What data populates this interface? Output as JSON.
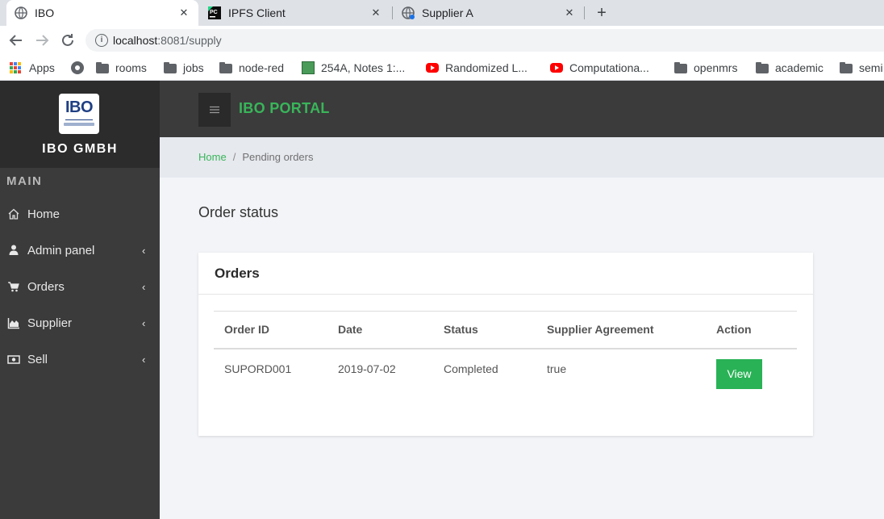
{
  "browser": {
    "tabs": [
      {
        "title": "IBO",
        "icon": "globe-icon",
        "active": true
      },
      {
        "title": "IPFS Client",
        "icon": "pycharm-icon",
        "active": false
      },
      {
        "title": "Supplier A",
        "icon": "globe-icon",
        "active": false
      }
    ],
    "close_glyph": "✕",
    "new_tab_glyph": "+",
    "url_host": "localhost",
    "url_path": ":8081/supply",
    "bookmarks": [
      {
        "label": "Apps",
        "icon": "apps-grid-icon"
      },
      {
        "label": "",
        "icon": "globe-icon"
      },
      {
        "label": "rooms",
        "icon": "folder-icon"
      },
      {
        "label": "jobs",
        "icon": "folder-icon"
      },
      {
        "label": "node-red",
        "icon": "folder-icon"
      },
      {
        "label": "254A, Notes 1:...",
        "icon": "sheet-icon"
      },
      {
        "label": "Randomized L...",
        "icon": "youtube-icon"
      },
      {
        "label": "Computationa...",
        "icon": "youtube-icon"
      },
      {
        "label": "openmrs",
        "icon": "folder-icon"
      },
      {
        "label": "academic",
        "icon": "folder-icon"
      },
      {
        "label": "semi",
        "icon": "folder-icon"
      }
    ]
  },
  "sidebar": {
    "logo_text": "IBO",
    "brand": "IBO GMBH",
    "section": "MAIN",
    "items": [
      {
        "label": "Home",
        "icon": "home-icon",
        "chevron": ""
      },
      {
        "label": "Admin panel",
        "icon": "user-icon",
        "chevron": "‹"
      },
      {
        "label": "Orders",
        "icon": "cart-icon",
        "chevron": "‹"
      },
      {
        "label": "Supplier",
        "icon": "area-chart-icon",
        "chevron": "‹"
      },
      {
        "label": "Sell",
        "icon": "money-icon",
        "chevron": "‹"
      }
    ]
  },
  "header": {
    "title": "IBO PORTAL"
  },
  "breadcrumb": {
    "home": "Home",
    "separator": "/",
    "current": "Pending orders"
  },
  "main": {
    "title": "Order status",
    "card_title": "Orders",
    "columns": [
      "Order ID",
      "Date",
      "Status",
      "Supplier Agreement",
      "Action"
    ],
    "rows": [
      {
        "order_id": "SUPORD001",
        "date": "2019-07-02",
        "status": "Completed",
        "agreement": "true",
        "action": "View"
      }
    ]
  },
  "colors": {
    "accent_green": "#39b55a",
    "button_green": "#29b256",
    "sidebar_bg": "#3b3b3b"
  }
}
